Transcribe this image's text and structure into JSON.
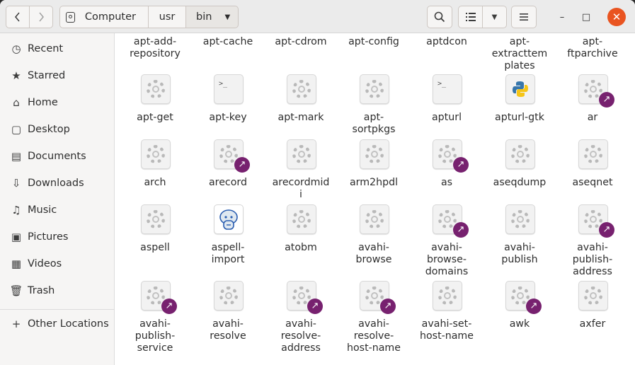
{
  "nav": {
    "back_icon": "chevron-left-icon",
    "forward_icon": "chevron-right-icon"
  },
  "path": {
    "crumbs": [
      "Computer",
      "usr",
      "bin"
    ]
  },
  "toolbar": {
    "search_icon": "search-icon",
    "view_icon": "list-view-icon",
    "menu_icon": "hamburger-menu-icon"
  },
  "window_controls": {
    "minimize": "–",
    "maximize": "□",
    "close": "✕",
    "close_color": "#e95420"
  },
  "sidebar": {
    "items": [
      {
        "label": "Recent",
        "icon": "clock-icon",
        "glyph": "◷"
      },
      {
        "label": "Starred",
        "icon": "star-icon",
        "glyph": "★"
      },
      {
        "label": "Home",
        "icon": "home-icon",
        "glyph": "⌂"
      },
      {
        "label": "Desktop",
        "icon": "desktop-icon",
        "glyph": "▢"
      },
      {
        "label": "Documents",
        "icon": "document-icon",
        "glyph": "▤"
      },
      {
        "label": "Downloads",
        "icon": "download-icon",
        "glyph": "⇩"
      },
      {
        "label": "Music",
        "icon": "music-icon",
        "glyph": "♫"
      },
      {
        "label": "Pictures",
        "icon": "picture-icon",
        "glyph": "▣"
      },
      {
        "label": "Videos",
        "icon": "video-icon",
        "glyph": "▦"
      },
      {
        "label": "Trash",
        "icon": "trash-icon",
        "glyph": "🗑"
      },
      {
        "label": "Other Locations",
        "icon": "plus-icon",
        "glyph": "+"
      }
    ]
  },
  "link_badge_color": "#77216f",
  "files": [
    [
      {
        "lines": [
          "apt-add-",
          "repository"
        ],
        "icon": "none"
      },
      {
        "lines": [
          "apt-cache"
        ],
        "icon": "none"
      },
      {
        "lines": [
          "apt-cdrom"
        ],
        "icon": "none"
      },
      {
        "lines": [
          "apt-config"
        ],
        "icon": "none"
      },
      {
        "lines": [
          "aptdcon"
        ],
        "icon": "none"
      },
      {
        "lines": [
          "apt-",
          "extracttem",
          "plates"
        ],
        "icon": "none"
      },
      {
        "lines": [
          "apt-",
          "ftparchive"
        ],
        "icon": "none"
      }
    ],
    [
      {
        "lines": [
          "apt-get"
        ],
        "icon": "gear"
      },
      {
        "lines": [
          "apt-key"
        ],
        "icon": "terminal"
      },
      {
        "lines": [
          "apt-mark"
        ],
        "icon": "gear"
      },
      {
        "lines": [
          "apt-",
          "sortpkgs"
        ],
        "icon": "gear"
      },
      {
        "lines": [
          "apturl"
        ],
        "icon": "terminal"
      },
      {
        "lines": [
          "apturl-gtk"
        ],
        "icon": "python"
      },
      {
        "lines": [
          "ar"
        ],
        "icon": "gear",
        "link": true
      }
    ],
    [
      {
        "lines": [
          "arch"
        ],
        "icon": "gear"
      },
      {
        "lines": [
          "arecord"
        ],
        "icon": "gear",
        "link": true
      },
      {
        "lines": [
          "arecordmid",
          "i"
        ],
        "icon": "gear"
      },
      {
        "lines": [
          "arm2hpdl"
        ],
        "icon": "gear"
      },
      {
        "lines": [
          "as"
        ],
        "icon": "gear",
        "link": true
      },
      {
        "lines": [
          "aseqdump"
        ],
        "icon": "gear"
      },
      {
        "lines": [
          "aseqnet"
        ],
        "icon": "gear"
      }
    ],
    [
      {
        "lines": [
          "aspell"
        ],
        "icon": "gear"
      },
      {
        "lines": [
          "aspell-",
          "import"
        ],
        "icon": "sheep"
      },
      {
        "lines": [
          "atobm"
        ],
        "icon": "gear"
      },
      {
        "lines": [
          "avahi-",
          "browse"
        ],
        "icon": "gear"
      },
      {
        "lines": [
          "avahi-",
          "browse-",
          "domains"
        ],
        "icon": "gear",
        "link": true
      },
      {
        "lines": [
          "avahi-",
          "publish"
        ],
        "icon": "gear"
      },
      {
        "lines": [
          "avahi-",
          "publish-",
          "address"
        ],
        "icon": "gear",
        "link": true
      }
    ],
    [
      {
        "lines": [
          "avahi-",
          "publish-",
          "service"
        ],
        "icon": "gear",
        "link": true
      },
      {
        "lines": [
          "avahi-",
          "resolve"
        ],
        "icon": "gear"
      },
      {
        "lines": [
          "avahi-",
          "resolve-",
          "address"
        ],
        "icon": "gear",
        "link": true
      },
      {
        "lines": [
          "avahi-",
          "resolve-",
          "host-name"
        ],
        "icon": "gear",
        "link": true
      },
      {
        "lines": [
          "avahi-set-",
          "host-name"
        ],
        "icon": "gear"
      },
      {
        "lines": [
          "awk"
        ],
        "icon": "gear",
        "link": true
      },
      {
        "lines": [
          "axfer"
        ],
        "icon": "gear"
      }
    ]
  ]
}
